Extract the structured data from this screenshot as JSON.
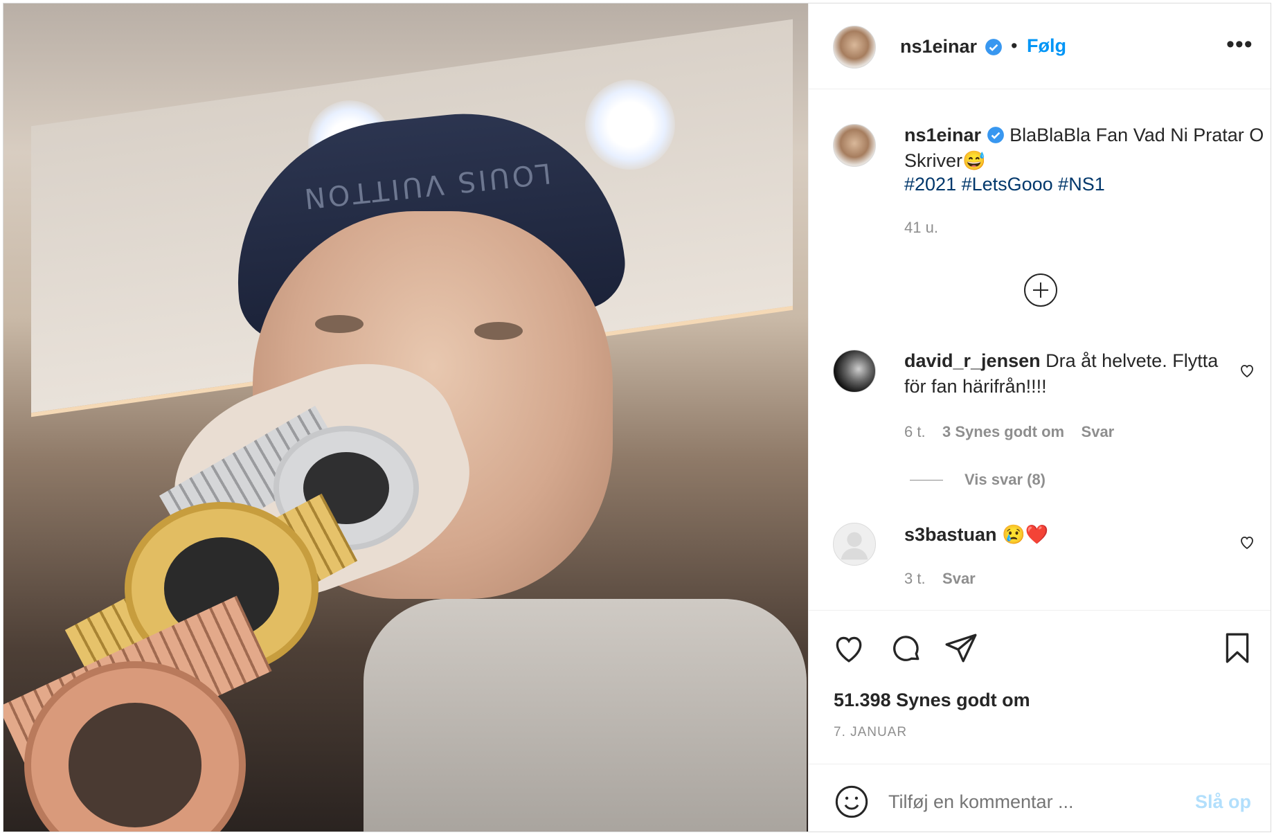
{
  "post": {
    "author": "ns1einar",
    "follow_label": "Følg",
    "separator": "•",
    "more_label": "•••",
    "caption_text": "BlaBlaBla Fan Vad Ni Pratar O Skriver😅",
    "hashtags": "#2021 #LetsGooo #NS1",
    "caption_time": "41 u.",
    "likes": "51.398 Synes godt om",
    "date": "7. JANUAR",
    "photo_text": "LOUIS VUITTON"
  },
  "comments": [
    {
      "user": "david_r_jensen",
      "text": "Dra åt helvete. Flytta för fan härifrån!!!!",
      "time": "6 t.",
      "likes": "3 Synes godt om",
      "reply": "Svar",
      "view_replies": "Vis svar (8)"
    },
    {
      "user": "s3bastuan",
      "text": "😢❤️",
      "time": "3 t.",
      "reply": "Svar"
    }
  ],
  "composer": {
    "placeholder": "Tilføj en kommentar ...",
    "post_label": "Slå op"
  },
  "colors": {
    "accent": "#0095f6",
    "hashtag": "#00376b",
    "muted": "#8e8e8e",
    "verified": "#3897f0"
  },
  "icons": [
    "verified-badge-icon",
    "more-options-icon",
    "load-more-icon",
    "heart-icon",
    "comment-icon",
    "share-icon",
    "save-icon",
    "emoji-icon"
  ]
}
